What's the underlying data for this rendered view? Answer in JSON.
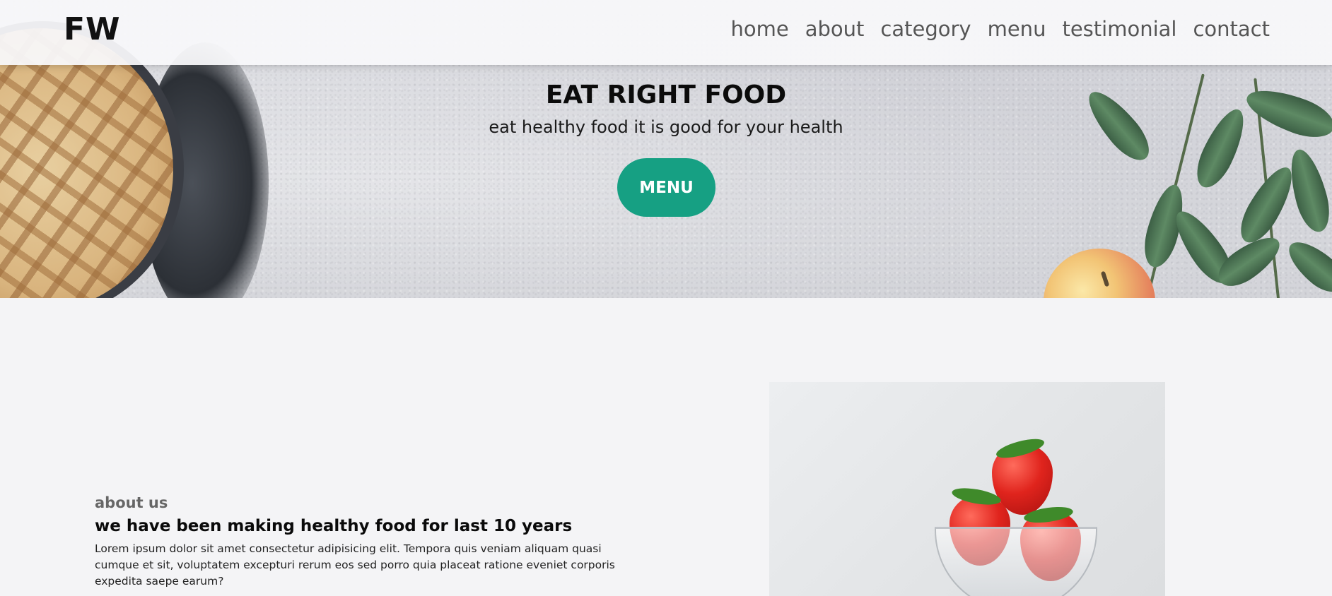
{
  "header": {
    "logo": "FW",
    "nav": [
      "home",
      "about",
      "category",
      "menu",
      "testimonial",
      "contact"
    ]
  },
  "hero": {
    "title": "EAT RIGHT FOOD",
    "subtitle": "eat healthy food it is good for your health",
    "button_label": "MENU"
  },
  "about": {
    "label": "about us",
    "heading": "we have been making healthy food for last 10 years",
    "text": "Lorem ipsum dolor sit amet consectetur adipisicing elit. Tempora quis veniam aliquam quasi cumque et sit, voluptatem excepturi rerum eos sed porro quia placeat ratione eveniet corporis expedita saepe earum?"
  },
  "colors": {
    "accent": "#16a083",
    "header_bg": "#f8f8fa",
    "page_bg": "#f4f4f6"
  }
}
